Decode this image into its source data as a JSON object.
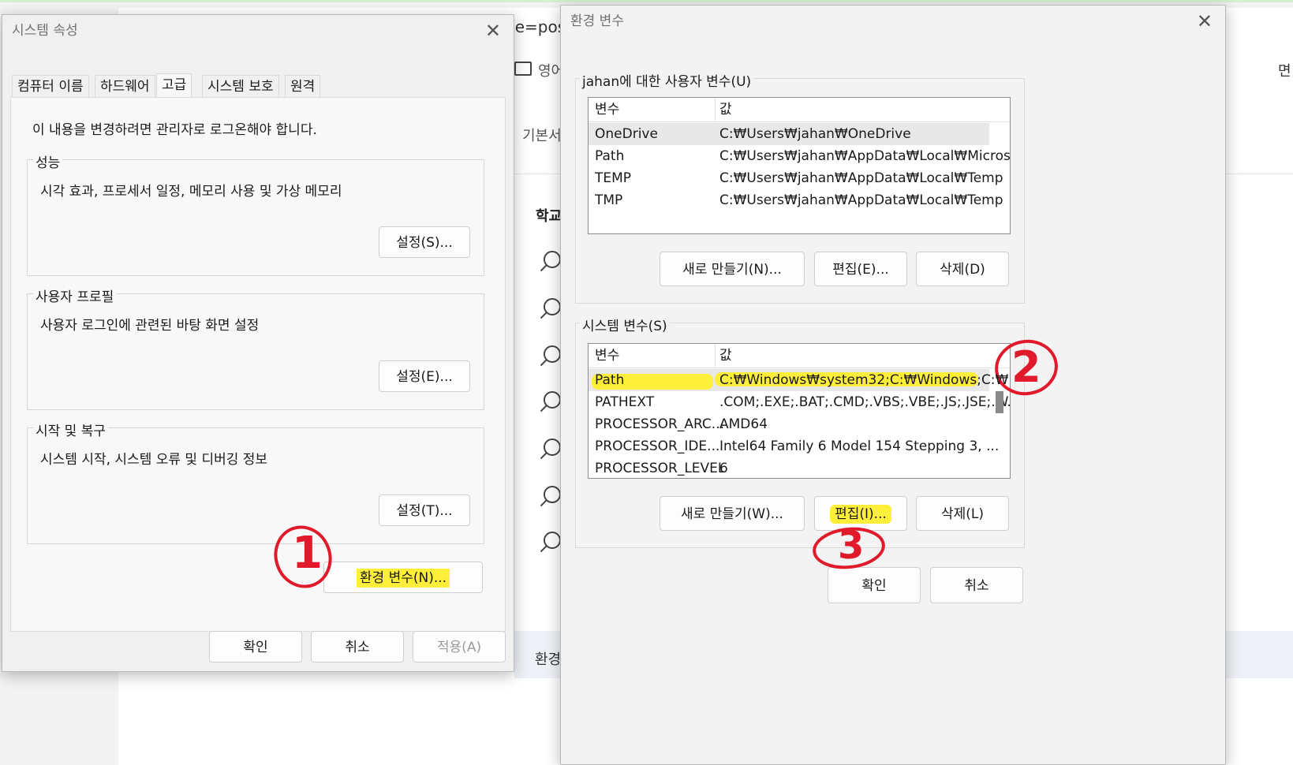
{
  "background": {
    "address_fragment": "pe=pos",
    "folder_label": "영어",
    "row_basic": "기본서",
    "row_school": "학교",
    "bottom_text": "환경",
    "right_edge_text": "면"
  },
  "system_properties": {
    "title": "시스템 속성",
    "tabs": [
      "컴퓨터 이름",
      "하드웨어",
      "고급",
      "시스템 보호",
      "원격"
    ],
    "notice": "이 내용을 변경하려면 관리자로 로그온해야 합니다.",
    "groups": [
      {
        "label": "성능",
        "desc": "시각 효과, 프로세서 일정, 메모리 사용 및 가상 메모리",
        "button": "설정(S)..."
      },
      {
        "label": "사용자 프로필",
        "desc": "사용자 로그인에 관련된 바탕 화면 설정",
        "button": "설정(E)..."
      },
      {
        "label": "시작 및 복구",
        "desc": "시스템 시작, 시스템 오류 및 디버깅 정보",
        "button": "설정(T)..."
      }
    ],
    "env_button": "환경 변수(N)...",
    "ok": "확인",
    "cancel": "취소",
    "apply": "적용(A)"
  },
  "env_vars": {
    "title": "환경 변수",
    "user_group_label": "jahan에 대한 사용자 변수(U)",
    "col_variable": "변수",
    "col_value": "값",
    "user_rows": [
      {
        "name": "OneDrive",
        "value": "C:₩Users₩jahan₩OneDrive"
      },
      {
        "name": "Path",
        "value": "C:₩Users₩jahan₩AppData₩Local₩Micros..."
      },
      {
        "name": "TEMP",
        "value": "C:₩Users₩jahan₩AppData₩Local₩Temp"
      },
      {
        "name": "TMP",
        "value": "C:₩Users₩jahan₩AppData₩Local₩Temp"
      }
    ],
    "user_buttons": {
      "new": "새로 만들기(N)...",
      "edit": "편집(E)...",
      "delete": "삭제(D)"
    },
    "system_group_label": "시스템 변수(S)",
    "system_rows": [
      {
        "name": "Path",
        "value": "C:₩Windows₩system32;C:₩Windows;C:₩..."
      },
      {
        "name": "PATHEXT",
        "value": ".COM;.EXE;.BAT;.CMD;.VBS;.VBE;.JS;.JSE;.W..."
      },
      {
        "name": "PROCESSOR_ARC...",
        "value": "AMD64"
      },
      {
        "name": "PROCESSOR_IDE...",
        "value": "Intel64 Family 6 Model 154 Stepping 3, ..."
      },
      {
        "name": "PROCESSOR_LEVEL",
        "value": "6"
      }
    ],
    "system_buttons": {
      "new": "새로 만들기(W)...",
      "edit": "편집(I)...",
      "delete": "삭제(L)"
    },
    "ok": "확인",
    "cancel": "취소"
  },
  "annotations": [
    "1",
    "2",
    "3"
  ],
  "colors": {
    "highlight": "#ffef3a",
    "annotation": "#e01a2b"
  }
}
